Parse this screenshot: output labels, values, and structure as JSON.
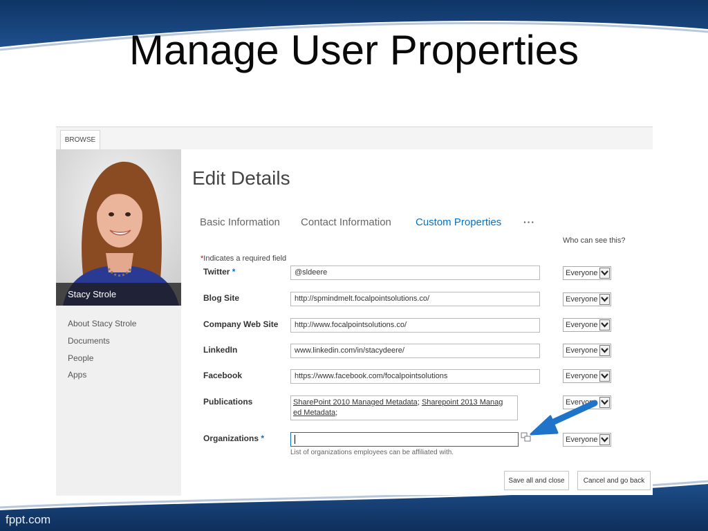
{
  "slide": {
    "title": "Manage User Properties",
    "footer_brand": "fppt.com",
    "frame_color": "#173e73"
  },
  "ribbon": {
    "browse_tab": "BROWSE"
  },
  "profile": {
    "name": "Stacy Strole",
    "nav": [
      "About Stacy Strole",
      "Documents",
      "People",
      "Apps"
    ]
  },
  "page": {
    "heading": "Edit Details",
    "tabs": [
      {
        "label": "Basic Information",
        "active": false
      },
      {
        "label": "Contact Information",
        "active": false
      },
      {
        "label": "Custom Properties",
        "active": true
      }
    ],
    "more": "···",
    "who_label": "Who can see this?",
    "required_note": "Indicates a required field",
    "required_mark": "*"
  },
  "fields": [
    {
      "label": "Twitter",
      "required": true,
      "value": "@sldeere",
      "visibility": "Everyone"
    },
    {
      "label": "Blog Site",
      "required": false,
      "value": "http://spmindmelt.focalpointsolutions.co/",
      "visibility": "Everyone"
    },
    {
      "label": "Company Web Site",
      "required": false,
      "value": "http://www.focalpointsolutions.co/",
      "visibility": "Everyone"
    },
    {
      "label": "LinkedIn",
      "required": false,
      "value": "www.linkedin.com/in/stacydeere/",
      "visibility": "Everyone"
    },
    {
      "label": "Facebook",
      "required": false,
      "value": "https://www.facebook.com/focalpointsolutions",
      "visibility": "Everyone"
    },
    {
      "label": "Publications",
      "required": false,
      "value_line1_a": "SharePoint 2010 Managed Metadata",
      "value_line1_sep": "; ",
      "value_line1_b": "Sharepoint 2013 Manag",
      "value_line2": "ed Metadata",
      "value_line2_sep": ";",
      "visibility": "Everyone"
    },
    {
      "label": "Organizations",
      "required": true,
      "value": "",
      "visibility": "Everyone",
      "helper": "List of organizations employees can be affiliated with."
    }
  ],
  "buttons": {
    "save": "Save all and close",
    "cancel": "Cancel and go back"
  },
  "colors": {
    "accent": "#0072c6",
    "required": "#cc0000",
    "arrow": "#1f73c8"
  },
  "icons": {
    "dropdown": "chevron-down-icon",
    "picker": "address-book-icon",
    "callout": "arrow-icon"
  }
}
